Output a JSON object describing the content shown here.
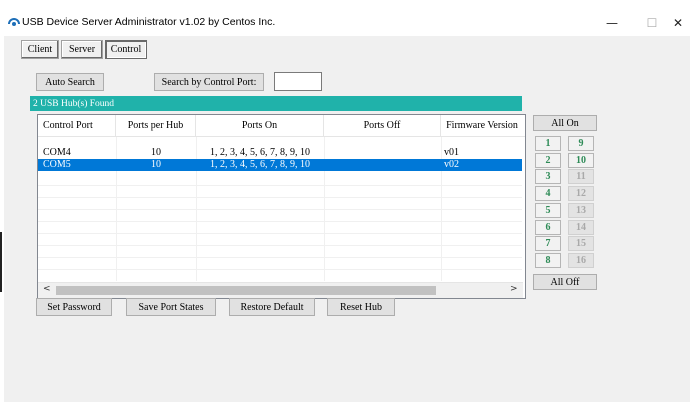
{
  "window": {
    "title": "USB Device Server Administrator v1.02 by Centos Inc.",
    "minimize_glyph": "—",
    "maximize_glyph": "☐",
    "close_glyph": "✕"
  },
  "tabs": [
    {
      "label": "Client",
      "active": false
    },
    {
      "label": "Server",
      "active": false
    },
    {
      "label": "Control",
      "active": true
    }
  ],
  "toolbar": {
    "auto_search_label": "Auto Search",
    "search_by_port_label": "Search by Control Port:",
    "control_port_value": ""
  },
  "hub_status": "2 USB Hub(s) Found",
  "table": {
    "columns": [
      "Control Port",
      "Ports per Hub",
      "Ports On",
      "Ports Off",
      "Firmware Version"
    ],
    "rows": [
      {
        "control_port": "COM4",
        "ports_per_hub": "10",
        "ports_on": "1, 2, 3, 4, 5, 6, 7, 8, 9, 10",
        "ports_off": "",
        "firmware": "v01",
        "selected": false
      },
      {
        "control_port": "COM5",
        "ports_per_hub": "10",
        "ports_on": "1, 2, 3, 4, 5, 6, 7, 8, 9, 10",
        "ports_off": "",
        "firmware": "v02",
        "selected": true
      }
    ],
    "scroll_left": "<",
    "scroll_right": ">"
  },
  "bottom_buttons": {
    "set_password": "Set Password",
    "save_port_states": "Save Port States",
    "restore_default": "Restore Default",
    "reset_hub": "Reset Hub"
  },
  "port_panel": {
    "all_on": "All On",
    "all_off": "All Off",
    "ports": [
      {
        "label": "1",
        "state": "on"
      },
      {
        "label": "9",
        "state": "on"
      },
      {
        "label": "2",
        "state": "on"
      },
      {
        "label": "10",
        "state": "on"
      },
      {
        "label": "3",
        "state": "on"
      },
      {
        "label": "11",
        "state": "off"
      },
      {
        "label": "4",
        "state": "on"
      },
      {
        "label": "12",
        "state": "off"
      },
      {
        "label": "5",
        "state": "on"
      },
      {
        "label": "13",
        "state": "off"
      },
      {
        "label": "6",
        "state": "on"
      },
      {
        "label": "14",
        "state": "off"
      },
      {
        "label": "7",
        "state": "on"
      },
      {
        "label": "15",
        "state": "off"
      },
      {
        "label": "8",
        "state": "on"
      },
      {
        "label": "16",
        "state": "off"
      }
    ]
  },
  "colors": {
    "hub_bar": "#20b2aa",
    "selection": "#0078d7",
    "port_on_text": "#2e8b57",
    "port_off_text": "#a9a9a9"
  }
}
